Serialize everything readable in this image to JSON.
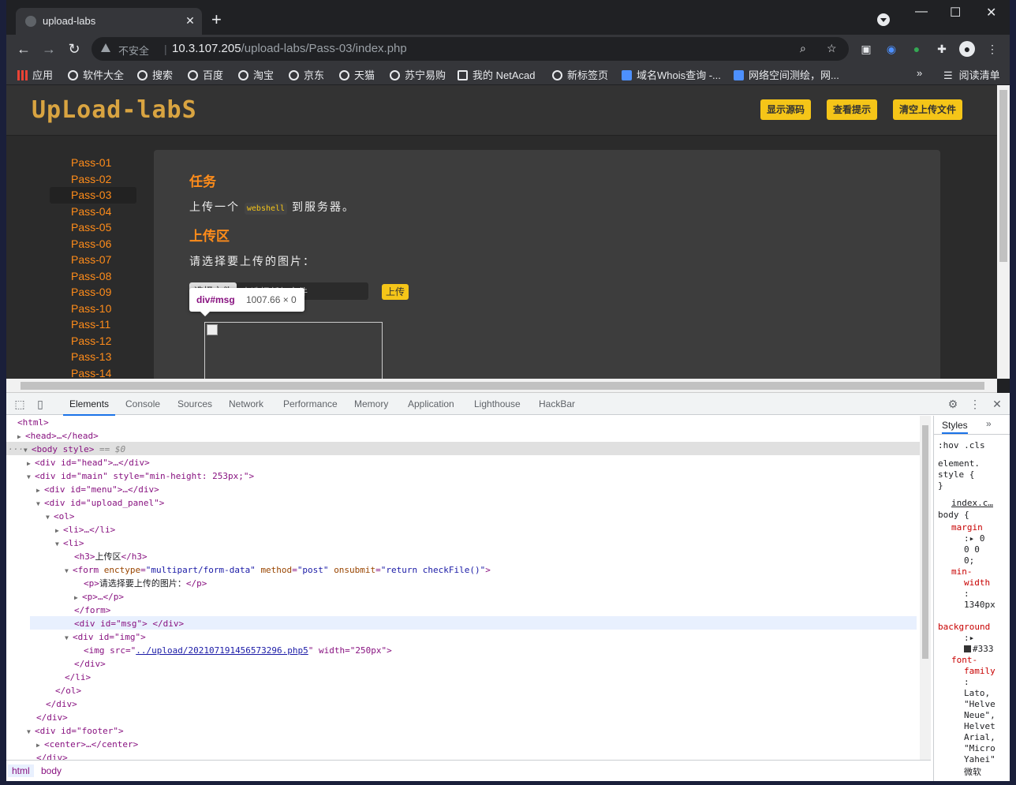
{
  "browser": {
    "tab_title": "upload-labs",
    "omnibox": {
      "security_text": "不安全",
      "url_host": "10.3.107.205",
      "url_path": "/upload-labs/Pass-03/index.php"
    },
    "bookmarks": [
      {
        "label": "应用",
        "icon": "apps-icon"
      },
      {
        "label": "软件大全",
        "icon": "globe-icon"
      },
      {
        "label": "搜索",
        "icon": "globe-icon"
      },
      {
        "label": "百度",
        "icon": "globe-icon"
      },
      {
        "label": "淘宝",
        "icon": "globe-icon"
      },
      {
        "label": "京东",
        "icon": "globe-icon"
      },
      {
        "label": "天猫",
        "icon": "globe-icon"
      },
      {
        "label": "苏宁易购",
        "icon": "globe-icon"
      },
      {
        "label": "我的 NetAcad",
        "icon": "netacad-icon"
      },
      {
        "label": "新标签页",
        "icon": "globe-icon"
      },
      {
        "label": "域名Whois查询 -...",
        "icon": "whois-icon"
      },
      {
        "label": "网络空间测绘，网...",
        "icon": "fofa-icon"
      }
    ],
    "reading_list": "阅读清单",
    "more_bookmarks": "»"
  },
  "page": {
    "logo": "UpLoad-labS",
    "header_buttons": [
      "显示源码",
      "查看提示",
      "清空上传文件"
    ],
    "menu": [
      "Pass-01",
      "Pass-02",
      "Pass-03",
      "Pass-04",
      "Pass-05",
      "Pass-06",
      "Pass-07",
      "Pass-08",
      "Pass-09",
      "Pass-10",
      "Pass-11",
      "Pass-12",
      "Pass-13",
      "Pass-14"
    ],
    "active_menu": "Pass-03",
    "task_title": "任务",
    "task_text_before": "上传一个",
    "task_code": "webshell",
    "task_text_after": "到服务器。",
    "upload_title": "上传区",
    "upload_prompt": "请选择要上传的图片：",
    "choose_file": "选择文件",
    "no_file": "未选择任何文件",
    "upload_button": "上传",
    "tooltip_tag": "div#msg",
    "tooltip_dim": "1007.66 × 0"
  },
  "devtools": {
    "tabs": [
      "Elements",
      "Console",
      "Sources",
      "Network",
      "Performance",
      "Memory",
      "Application",
      "Lighthouse",
      "HackBar"
    ],
    "active_tab": "Elements",
    "dom": {
      "l0": "<html>",
      "l1": "<head>…</head>",
      "l2_tag": "<body style>",
      "l2_eq": " == $0",
      "l3": "<div id=\"head\">…</div>",
      "l4_open": "<div id=\"main\" style=\"min-height: 253px;\">",
      "l5": "<div id=\"menu\">…</div>",
      "l6": "<div id=\"upload_panel\">",
      "l7": "<ol>",
      "l8": "<li>…</li>",
      "l9": "<li>",
      "l10_tag_open": "<h3>",
      "l10_text": "上传区",
      "l10_tag_close": "</h3>",
      "l11_form": "<form",
      "l11_a1": "enctype",
      "l11_v1": "\"multipart/form-data\"",
      "l11_a2": "method",
      "l11_v2": "\"post\"",
      "l11_a3": "onsubmit",
      "l11_v3": "\"return checkFile()\"",
      "l12_open": "<p>",
      "l12_text": "请选择要上传的图片：",
      "l12_close": "</p>",
      "l13": "<p>…</p>",
      "l14": "</form>",
      "l15": "<div id=\"msg\"> </div>",
      "l16": "<div id=\"img\">",
      "l17_open": "<img src=\"",
      "l17_link": "../upload/202107191456573296.php5",
      "l17_close": "\" width=\"250px\">",
      "l18": "</div>",
      "l19": "</li>",
      "l20": "</ol>",
      "l21": "</div>",
      "l22": "</div>",
      "l23": "<div id=\"footer\">",
      "l24": "<center>…</center>",
      "l25": "</div>"
    },
    "breadcrumbs": [
      "html",
      "body"
    ],
    "styles": {
      "tab": "Styles",
      "hov": ":hov",
      "cls": ".cls",
      "element_style_1": "element.",
      "element_style_2": "style {",
      "element_style_3": "}",
      "source": "index.c…",
      "selector": "body {",
      "p1": "margin",
      "p1v1": ":▸ 0",
      "p1v2": "0 0",
      "p1v3": "0;",
      "p2a": "min-",
      "p2b": "width",
      "p2v1": ":",
      "p2v2": "1340px",
      "p3": "background",
      "p3v1": ":▸",
      "p3v2": "#333",
      "p4a": "font-",
      "p4b": "family",
      "p4v1": ":",
      "p4v2": "Lato,",
      "p4v3": "\"Helve",
      "p4v4": "Neue\",",
      "p4v5": "Helvet",
      "p4v6": "Arial,",
      "p4v7": "\"Micro",
      "p4v8": "Yahei\"",
      "p4v9": "微软"
    }
  }
}
